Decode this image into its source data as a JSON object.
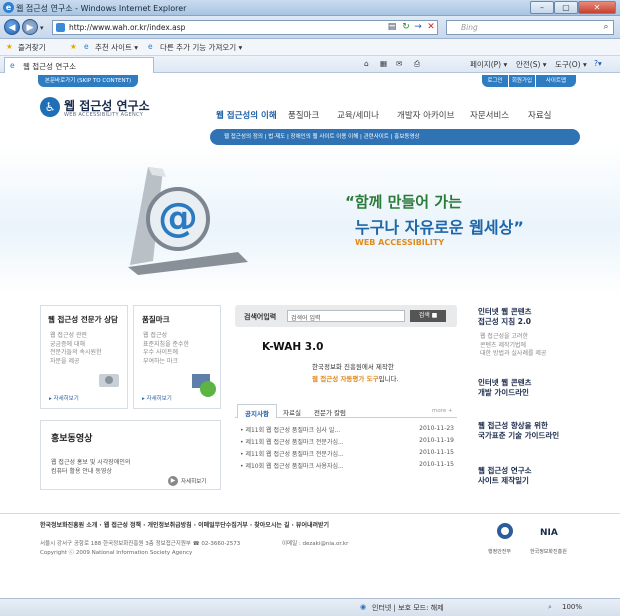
{
  "window": {
    "title": "웹 접근성 연구소 - Windows Internet Explorer",
    "ie_icon": "e"
  },
  "address": {
    "url": "http://www.wah.or.kr/index.asp",
    "search_placeholder": "Bing"
  },
  "favorites": {
    "fav_label": "즐겨찾기",
    "suggested": "추천 사이트 ▾",
    "more_addons": "다른 추가 기능 가져오기 ▾"
  },
  "tab": {
    "title": "웹 접근성 연구소",
    "cmds": {
      "page": "페이지(P) ▾",
      "safety": "안전(S) ▾",
      "tools": "도구(O) ▾"
    }
  },
  "site": {
    "skip": "본문바로가기 (SKIP TO CONTENT)",
    "util": [
      "로그인",
      "회원가입",
      "사이트맵"
    ],
    "logo": {
      "name": "웹 접근성 연구소",
      "sub": "WEB ACCESSIBILITY AGENCY"
    },
    "gnb": [
      "웹 접근성의 이해",
      "품질마크",
      "교육/세미나",
      "개발자 아카이브",
      "자문서비스",
      "자료실"
    ],
    "subnav": "웹 접근성의 정의  |  법·제도  |  장애인의 웹 사이트 이용 이해  |  관련사이트  |  홍보동영상",
    "hero": {
      "line1": "“함께 만들어 가는",
      "line2": "누구나 자유로운 웹세상”",
      "line3": "WEB ACCESSIBILITY"
    },
    "boxes": [
      {
        "title": "웹 접근성 전문가 상담",
        "desc": [
          "웹 접근성 관련",
          "궁금증에 대해",
          "전문가들의 속시원한",
          "자문을 제공"
        ],
        "more": "▸ 자세히보기"
      },
      {
        "title": "품질마크",
        "desc": [
          "웹 접근성",
          "표준지침을 준수한",
          "우수 사이트에",
          "부여하는 마크"
        ],
        "more": "▸ 자세히보기"
      }
    ],
    "video": {
      "title": "홍보동영상",
      "desc": [
        "웹 접근성 홍보 및 시각장애인의",
        "컴퓨터 활용 안내 동영상"
      ],
      "more": "자세히보기"
    },
    "search": {
      "label": "검색어입력",
      "placeholder": "검색어 입력",
      "button": "검색 ■"
    },
    "kwah": {
      "title": "K-WAH 3.0",
      "desc1": "한국정보화 진흥원에서 제작한",
      "desc2_hl": "웹 접근성 자동평가 도구",
      "desc2_rest": "입니다."
    },
    "news": {
      "tabs": [
        "공지사항",
        "자료실",
        "전문가 칼럼"
      ],
      "more": "more +",
      "rows": [
        {
          "t": "• 제11회 웹 접근성 품질마크 심사 일...",
          "d": "2010-11-23"
        },
        {
          "t": "• 제11회 웹 접근성 품질마크 전문가심...",
          "d": "2010-11-19"
        },
        {
          "t": "• 제11회 웹 접근성 품질마크 전문가심...",
          "d": "2010-11-15"
        },
        {
          "t": "• 제10회 웹 접근성 품질마크 사용자심...",
          "d": "2010-11-15"
        }
      ]
    },
    "right": [
      {
        "title": [
          "인터넷 웹 콘텐츠",
          "접근성 지침 2.0"
        ],
        "desc": [
          "웹 접근성을 고려한",
          "콘텐츠 제작기법에",
          "대한 방법과 실사례를 제공"
        ]
      },
      {
        "title": [
          "인터넷 웹 콘텐츠",
          "개발 가이드라인"
        ]
      },
      {
        "title": [
          "웹 접근성 향상을 위한",
          "국가표준 기술 가이드라인"
        ]
      },
      {
        "title": [
          "웹 접근성 연구소",
          "사이트 제작일기"
        ]
      }
    ],
    "footer": {
      "nav": "한국정보화진흥원 소개  ·  웹 접근성 정책  ·  개인정보취급방침  ·  이메일무단수집거부  ·  찾아오시는 길  ·  뷰어내려받기",
      "addr": "서울시 강서구 공항로 188 한국정보화진흥원 3층 정보접근지원부 ☎ 02-3660-2573",
      "copy": "Copyright ⓒ 2009 National Information Society Agency",
      "email": "이메일 : dezaki@nia.or.kr",
      "logos": [
        "행정안전부",
        "한국정보화진흥원"
      ],
      "nia": "NIA"
    }
  },
  "status": {
    "zone": "인터넷 | 보호 모드: 해제",
    "zoom": "100%"
  }
}
